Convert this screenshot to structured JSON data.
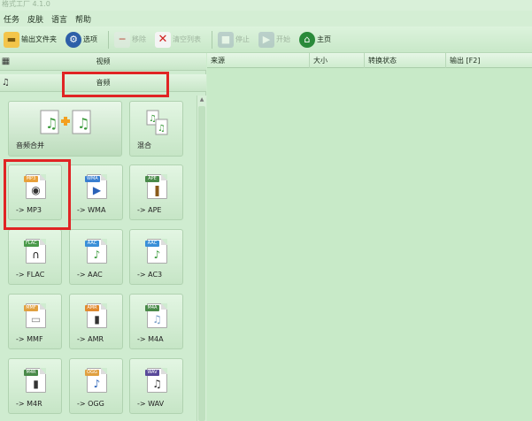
{
  "window": {
    "title": "格式工厂 4.1.0"
  },
  "menu": [
    "任务",
    "皮肤",
    "语言",
    "帮助"
  ],
  "toolbar": [
    {
      "label": "输出文件夹",
      "icon": "folder-icon",
      "disabled": false
    },
    {
      "label": "选项",
      "icon": "options-icon",
      "disabled": false
    },
    {
      "label": "移除",
      "icon": "remove-icon",
      "disabled": true
    },
    {
      "label": "清空列表",
      "icon": "clear-list-icon",
      "disabled": true
    },
    {
      "label": "停止",
      "icon": "stop-icon",
      "disabled": true
    },
    {
      "label": "开始",
      "icon": "start-icon",
      "disabled": true
    },
    {
      "label": "主页",
      "icon": "home-icon",
      "disabled": false
    }
  ],
  "categories": {
    "video": "视频",
    "audio": "音频"
  },
  "audio_tiles": [
    {
      "label": "音频合并",
      "icon": "audio-merge-icon"
    },
    {
      "label": "混合",
      "icon": "audio-mix-icon"
    },
    {
      "label": "-> MP3",
      "tag": "MP3",
      "tag_color": "#e8a03a",
      "icon": "mp3-file-icon"
    },
    {
      "label": "-> WMA",
      "tag": "WMA",
      "tag_color": "#3a7fd0",
      "icon": "wma-file-icon"
    },
    {
      "label": "-> APE",
      "tag": "APE",
      "tag_color": "#4a8a4a",
      "icon": "ape-file-icon"
    },
    {
      "label": "-> FLAC",
      "tag": "FLAC",
      "tag_color": "#4a9a4a",
      "icon": "flac-file-icon"
    },
    {
      "label": "-> AAC",
      "tag": "AAC",
      "tag_color": "#3a8fd8",
      "icon": "aac-file-icon"
    },
    {
      "label": "-> AC3",
      "tag": "AAC",
      "tag_color": "#3a8fd8",
      "icon": "ac3-file-icon"
    },
    {
      "label": "-> MMF",
      "tag": "MMF",
      "tag_color": "#e0a040",
      "icon": "mmf-file-icon"
    },
    {
      "label": "-> AMR",
      "tag": "AMR",
      "tag_color": "#e08a30",
      "icon": "amr-file-icon"
    },
    {
      "label": "-> M4A",
      "tag": "M4A",
      "tag_color": "#4a8a4a",
      "icon": "m4a-file-icon"
    },
    {
      "label": "-> M4R",
      "tag": "M4R",
      "tag_color": "#4a8a4a",
      "icon": "m4r-file-icon"
    },
    {
      "label": "-> OGG",
      "tag": "OGG",
      "tag_color": "#e0a040",
      "icon": "ogg-file-icon"
    },
    {
      "label": "-> WAV",
      "tag": "WAV",
      "tag_color": "#5a4a9a",
      "icon": "wav-file-icon"
    }
  ],
  "task_list": {
    "columns": [
      "来源",
      "大小",
      "转换状态",
      "输出 [F2]"
    ]
  },
  "colors": {
    "background": "#cdeccd",
    "highlight": "#e02424"
  }
}
